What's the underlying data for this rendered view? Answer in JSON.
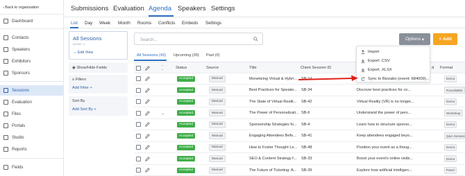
{
  "nav": {
    "back": "Back to organization",
    "items": [
      {
        "label": "Dashboard",
        "icon": "dashboard-icon"
      },
      {
        "label": "Contacts",
        "icon": "contacts-icon"
      },
      {
        "label": "Speakers",
        "icon": "microphone-icon"
      },
      {
        "label": "Exhibitors",
        "icon": "booth-icon"
      },
      {
        "label": "Sponsors",
        "icon": "megaphone-icon"
      },
      {
        "label": "Sessions",
        "icon": "calendar-icon",
        "active": true
      },
      {
        "label": "Evaluation",
        "icon": "evaluation-icon"
      },
      {
        "label": "Files",
        "icon": "file-icon"
      },
      {
        "label": "Portals",
        "icon": "portal-icon"
      },
      {
        "label": "Studio",
        "icon": "studio-icon"
      },
      {
        "label": "Reports",
        "icon": "reports-icon"
      },
      {
        "label": "Fields",
        "icon": "fields-icon"
      }
    ]
  },
  "top_tabs": [
    "Submissions",
    "Evaluation",
    "Agenda",
    "Speakers",
    "Settings"
  ],
  "top_tabs_active": "Agenda",
  "sub_tabs": [
    "List",
    "Day",
    "Week",
    "Month",
    "Rooms",
    "Conflicts",
    "Embeds",
    "Settings"
  ],
  "sub_tabs_active": "List",
  "panel": {
    "title": "All Sessions",
    "subtitle": "(NONE ↓)",
    "edit_view": "Edit View",
    "show_hide": "Show/Hide Fields",
    "filters": "Filters",
    "add_filter": "Add Filter",
    "sort_by": "Sort By",
    "add_sort": "Add Sort By"
  },
  "toolbar": {
    "search_placeholder": "Search...",
    "options": "Options",
    "add": "Add"
  },
  "session_tabs": [
    "All Sessions (43)",
    "Upcoming (39)",
    "Past (0)"
  ],
  "dropdown": [
    "Import",
    "Export .CSV",
    "Export .XLSX",
    "Sync to Bizzabo (event: 684009)..."
  ],
  "table": {
    "headers": {
      "status": "Status",
      "source": "Source",
      "title": "Title",
      "client_id": "Client Session ID",
      "d": "d",
      "format": "Format"
    },
    "rows": [
      {
        "status": "Accepted",
        "source": "Manual",
        "title": "Monetizing Virtual & Hybri...",
        "id": "SB-14",
        "desc": "",
        "format": "Demo"
      },
      {
        "status": "Accepted",
        "source": "Manual",
        "title": "Best Practices for Speake...",
        "id": "SB-34",
        "desc": "Discover best practices for co...",
        "format": "Roundtable"
      },
      {
        "status": "Accepted",
        "source": "Manual",
        "title": "The State of Virtual Realit...",
        "id": "SB-42",
        "desc": "Virtual Reality (VR) is no longer...",
        "format": "Demo"
      },
      {
        "status": "Accepted",
        "source": "Manual",
        "title": "The Power of Personalizati...",
        "id": "SB-6",
        "desc": "Understand the power of pers...",
        "format": "Workshop"
      },
      {
        "status": "Accepted",
        "source": "Manual",
        "title": "Sponsorship Strategies fo...",
        "id": "SB-4",
        "desc": "Learn how to structure sponso...",
        "format": "Demo"
      },
      {
        "status": "Accepted",
        "source": "Manual",
        "title": "Engaging Attendees Befo...",
        "id": "SB-41",
        "desc": "Keep attendees engaged beyo...",
        "format": "Q&A Session"
      },
      {
        "status": "Accepted",
        "source": "Manual",
        "title": "How to Foster Thought Le...",
        "id": "SB-48",
        "desc": "Position your event as a thoug...",
        "format": "Demo"
      },
      {
        "status": "Accepted",
        "source": "Manual",
        "title": "SEO & Content Strategy f...",
        "id": "SB-33",
        "desc": "Boost your event's online visibi...",
        "format": "Demo"
      },
      {
        "status": "Accepted",
        "source": "Manual",
        "title": "The Future of Ticketing: A...",
        "id": "SB-39",
        "desc": "Explore how artificial intelligen...",
        "format": "Panel"
      }
    ]
  },
  "colors": {
    "accent": "#2d6fc1",
    "accepted": "#3fae49",
    "add": "#f5a623",
    "options": "#8a9099",
    "arrow": "#e0201b"
  }
}
